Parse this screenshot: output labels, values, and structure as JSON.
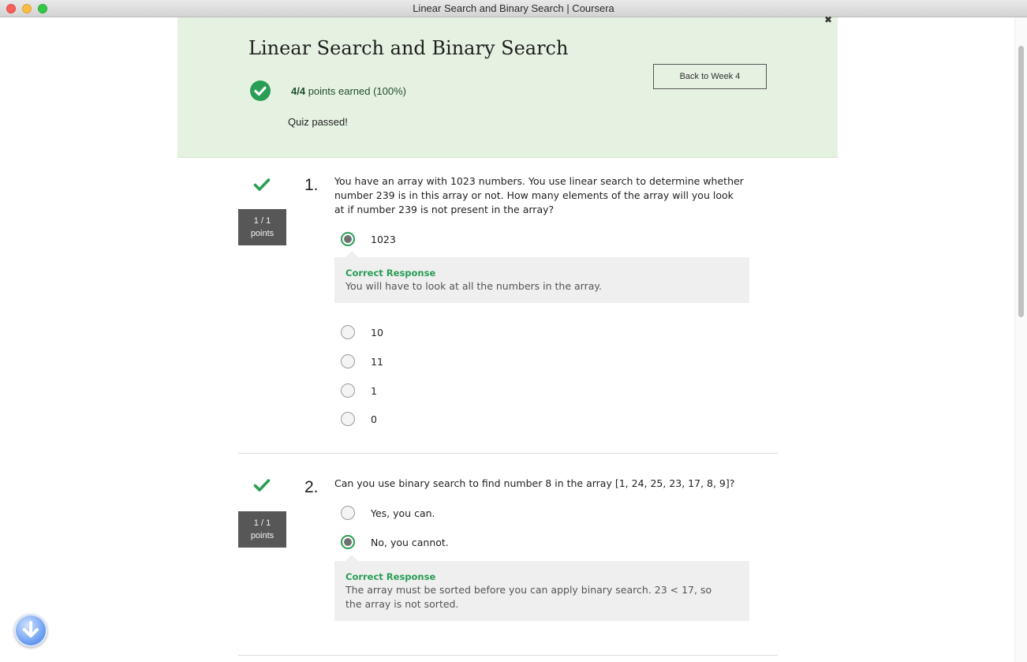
{
  "window": {
    "title": "Linear Search and Binary Search | Coursera"
  },
  "header": {
    "quiz_title": "Linear Search and Binary Search",
    "back_button_label": "Back to Week 4",
    "score_bold": "4/4",
    "score_rest": " points earned (100%)",
    "status": "Quiz passed!",
    "colors": {
      "band": "#e6f2e1",
      "accent": "#2a9d55"
    }
  },
  "questions": [
    {
      "number": "1.",
      "points_line1": "1 / 1",
      "points_line2": "points",
      "text": "You have an array with 1023 numbers. You use linear search to determine whether number 239 is in this array or not. How many elements of the array will you look at if number 239 is not present in the array?",
      "options": [
        {
          "label": "1023",
          "selected": true
        },
        {
          "label": "10",
          "selected": false
        },
        {
          "label": "11",
          "selected": false
        },
        {
          "label": "1",
          "selected": false
        },
        {
          "label": "0",
          "selected": false
        }
      ],
      "feedback_title": "Correct Response",
      "feedback_text": "You will have to look at all the numbers in the array."
    },
    {
      "number": "2.",
      "points_line1": "1 / 1",
      "points_line2": "points",
      "text": "Can you use binary search to find number 8 in the array [1, 24, 25, 23, 17, 8, 9]?",
      "options": [
        {
          "label": "Yes, you can.",
          "selected": false
        },
        {
          "label": "No, you cannot.",
          "selected": true
        }
      ],
      "feedback_title": "Correct Response",
      "feedback_text": "The array must be sorted before you can apply binary search. 23 < 17, so the array is not sorted."
    }
  ],
  "icons": {
    "close": "close-icon",
    "score": "check-circle-icon",
    "question_status": "checkmark-icon",
    "download": "download-arrow-icon"
  }
}
